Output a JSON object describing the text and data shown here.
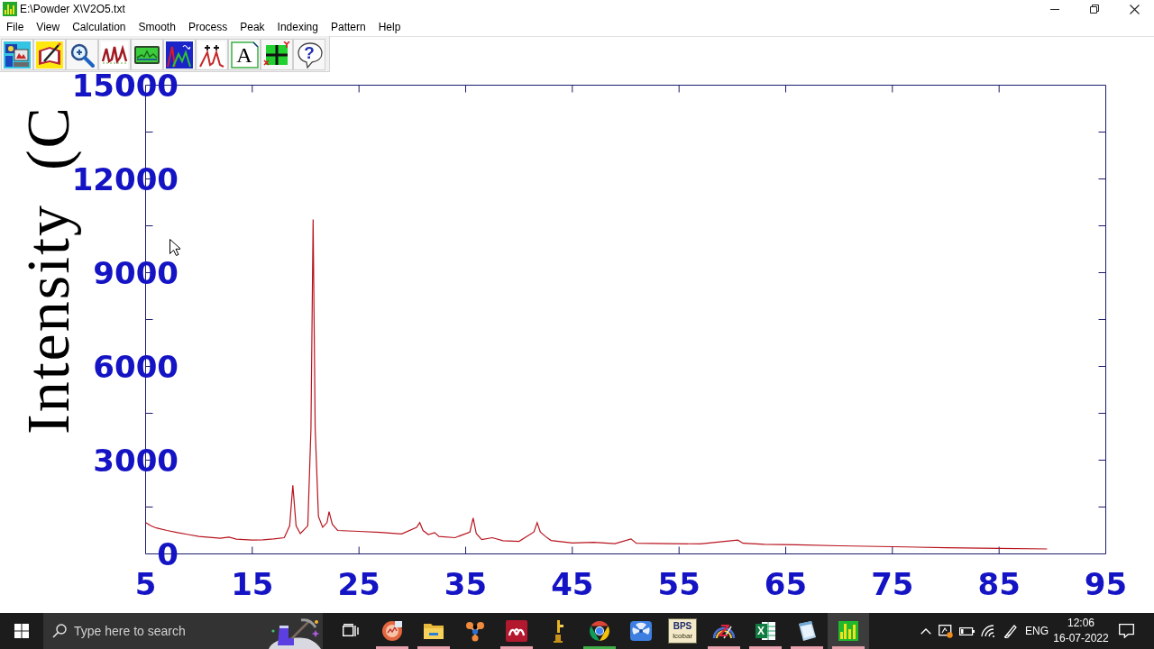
{
  "window": {
    "title": "E:\\Powder X\\V2O5.txt"
  },
  "menu": [
    "File",
    "View",
    "Calculation",
    "Smooth",
    "Process",
    "Peak",
    "Indexing",
    "Pattern",
    "Help"
  ],
  "toolbar": [
    {
      "kind": "computer"
    },
    {
      "kind": "notebook"
    },
    {
      "kind": "magnifier"
    },
    {
      "kind": "peaks"
    },
    {
      "kind": "screen"
    },
    {
      "kind": "tile_peaks"
    },
    {
      "kind": "markers"
    },
    {
      "kind": "text",
      "glyph": "A"
    },
    {
      "kind": "axes"
    },
    {
      "kind": "help",
      "glyph": "?"
    }
  ],
  "plot": {
    "chart_data": [
      {
        "type": "line",
        "ylabel": "Intensity (C",
        "xlim": [
          5,
          95
        ],
        "ylim": [
          0,
          15000
        ],
        "xticks": [
          5,
          15,
          25,
          35,
          45,
          55,
          65,
          75,
          85,
          95
        ],
        "yticks": [
          0,
          3000,
          6000,
          9000,
          12000,
          15000
        ],
        "color": "#b8141e",
        "x": [
          5,
          5.5,
          6,
          7,
          8,
          9,
          10,
          11,
          12,
          12.8,
          13.5,
          15,
          16,
          17,
          18,
          18.5,
          18.8,
          19.1,
          19.5,
          20.2,
          20.5,
          20.7,
          20.9,
          21.2,
          21.6,
          22,
          22.2,
          22.5,
          23,
          25,
          27,
          29,
          30.4,
          30.7,
          31,
          31.5,
          32.1,
          32.5,
          34,
          35.4,
          35.7,
          36,
          36.5,
          37.5,
          38.5,
          40,
          41.4,
          41.7,
          42,
          42.5,
          43,
          45,
          47,
          49,
          50.5,
          51,
          54,
          57,
          60.5,
          61,
          63,
          66,
          70,
          75,
          80,
          85,
          89.5
        ],
        "values": [
          1000,
          900,
          830,
          750,
          680,
          620,
          560,
          530,
          500,
          540,
          470,
          440,
          450,
          480,
          520,
          900,
          2200,
          900,
          650,
          900,
          4000,
          10700,
          4000,
          1200,
          850,
          1000,
          1350,
          950,
          750,
          720,
          690,
          640,
          850,
          1000,
          750,
          620,
          680,
          560,
          520,
          700,
          1150,
          650,
          460,
          520,
          420,
          400,
          700,
          1000,
          700,
          550,
          430,
          350,
          370,
          330,
          480,
          340,
          330,
          320,
          440,
          340,
          310,
          290,
          260,
          230,
          200,
          180,
          160
        ]
      }
    ]
  },
  "taskbar": {
    "search": {
      "placeholder": "Type here to search"
    },
    "apps": [
      {
        "kind": "orb",
        "running": true,
        "selected": false,
        "color": "#e8a2ae"
      },
      {
        "kind": "folder",
        "running": true,
        "selected": false,
        "color": "#e8a2ae"
      },
      {
        "kind": "nodes",
        "running": false,
        "selected": false
      },
      {
        "kind": "tile_logo",
        "running": true,
        "selected": false,
        "color": "#e8a2ae"
      },
      {
        "kind": "microscope",
        "running": false,
        "selected": false
      },
      {
        "kind": "circle_logo",
        "running": true,
        "selected": false,
        "color": "#3fae49"
      },
      {
        "kind": "fan_tile",
        "running": false,
        "selected": false
      },
      {
        "kind": "label_tile",
        "glyph": "BPS",
        "caption": "Icobar",
        "running": false,
        "selected": false
      },
      {
        "kind": "gauge",
        "glyph": "Z",
        "running": true,
        "selected": false,
        "color": "#e8a2ae"
      },
      {
        "kind": "sheet",
        "glyph": "X",
        "running": true,
        "selected": false,
        "color": "#e8a2ae"
      },
      {
        "kind": "notepad",
        "running": true,
        "selected": false,
        "color": "#e8a2ae"
      },
      {
        "kind": "chart_app",
        "running": true,
        "selected": true,
        "color": "#e8a2ae"
      }
    ],
    "tray": {
      "language": "ENG",
      "time": "12:06",
      "date": "16-07-2022"
    }
  }
}
